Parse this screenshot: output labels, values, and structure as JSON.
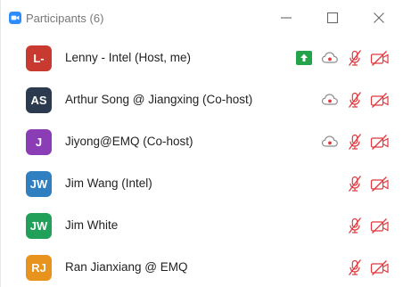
{
  "title": {
    "label": "Participants",
    "count": "(6)"
  },
  "icons": {
    "app": "zoom-camera-icon",
    "minimize": "minimize-icon",
    "maximize": "maximize-icon",
    "close": "close-icon",
    "share": "screen-share-icon",
    "record": "cloud-record-icon",
    "mic": "microphone-muted-icon",
    "camera": "video-off-icon"
  },
  "colors": {
    "muted_red": "#e0383e",
    "record_grey": "#8a8a8a",
    "share_green": "#23a34a"
  },
  "participants": [
    {
      "initials": "L-",
      "name": "Lenny - Intel (Host, me)",
      "avatar_color": "#c83a2f",
      "sharing": true,
      "recording": true,
      "mic_muted": true,
      "video_off": true
    },
    {
      "initials": "AS",
      "name": "Arthur Song @ Jiangxing (Co-host)",
      "avatar_color": "#2b3a4e",
      "sharing": false,
      "recording": true,
      "mic_muted": true,
      "video_off": true
    },
    {
      "initials": "J",
      "name": "Jiyong@EMQ (Co-host)",
      "avatar_color": "#8b3db5",
      "sharing": false,
      "recording": true,
      "mic_muted": true,
      "video_off": true
    },
    {
      "initials": "JW",
      "name": "Jim Wang (Intel)",
      "avatar_color": "#2f7fc1",
      "sharing": false,
      "recording": false,
      "mic_muted": true,
      "video_off": true
    },
    {
      "initials": "JW",
      "name": "Jim White",
      "avatar_color": "#21a05a",
      "sharing": false,
      "recording": false,
      "mic_muted": true,
      "video_off": true
    },
    {
      "initials": "RJ",
      "name": "Ran Jianxiang @ EMQ",
      "avatar_color": "#e8931e",
      "sharing": false,
      "recording": false,
      "mic_muted": true,
      "video_off": true
    }
  ]
}
